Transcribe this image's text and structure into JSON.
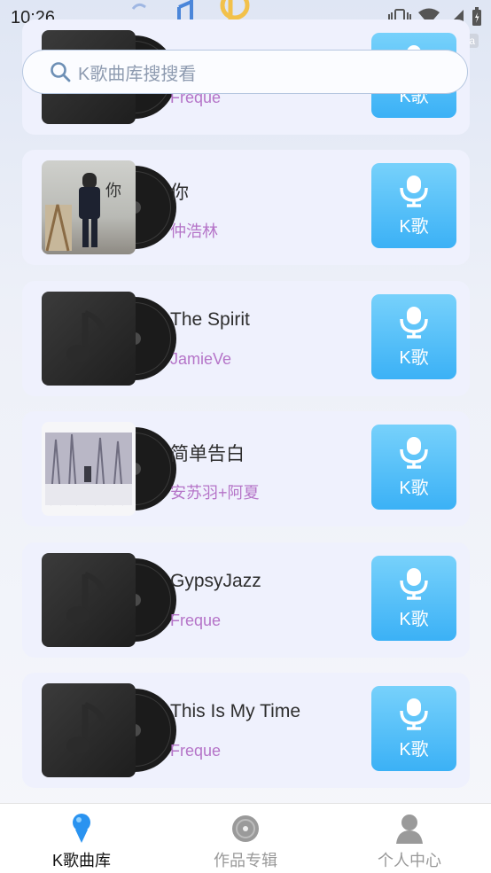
{
  "status": {
    "time": "10:26",
    "tag": "4fja"
  },
  "search": {
    "placeholder": "K歌曲库搜搜看"
  },
  "songs": [
    {
      "title": "",
      "artist": "Freque",
      "cover": "default"
    },
    {
      "title": "你",
      "artist": "仲浩林",
      "cover": "photo-man"
    },
    {
      "title": "The Spirit",
      "artist": "JamieVe",
      "cover": "default"
    },
    {
      "title": "简单告白",
      "artist": "安苏羽+阿夏",
      "cover": "photo-forest"
    },
    {
      "title": "GypsyJazz",
      "artist": "Freque",
      "cover": "default"
    },
    {
      "title": "This Is My Time",
      "artist": "Freque",
      "cover": "default"
    }
  ],
  "k_button_label": "K歌",
  "tabs": [
    {
      "label": "K歌曲库",
      "icon": "microphone-icon",
      "active": true
    },
    {
      "label": "作品专辑",
      "icon": "disc-icon",
      "active": false
    },
    {
      "label": "个人中心",
      "icon": "profile-icon",
      "active": false
    }
  ],
  "colors": {
    "accent": "#3bb1f6",
    "artist": "#b574c8",
    "card": "#eff1fd"
  }
}
